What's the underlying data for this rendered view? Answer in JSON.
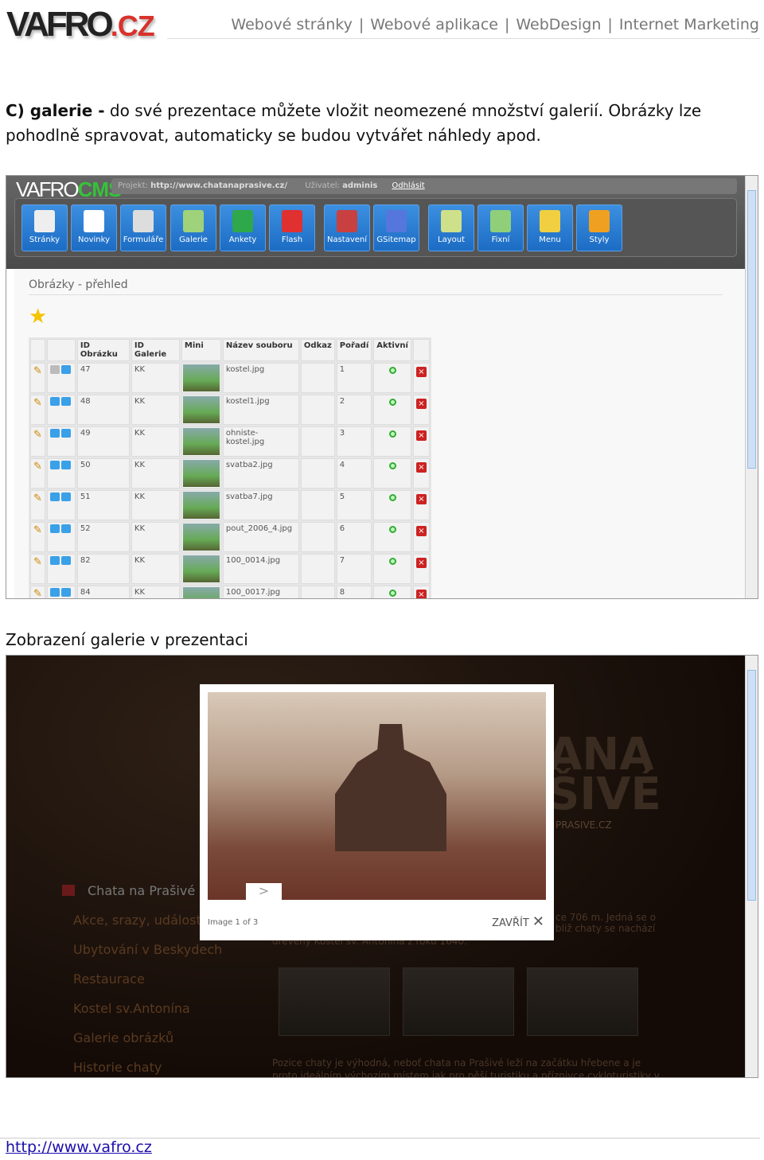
{
  "header": {
    "logo": "VAFRO",
    "logo_suffix": ".CZ",
    "nav": [
      "Webové stránky",
      "Webové aplikace",
      "WebDesign",
      "Internet Marketing"
    ],
    "nav_sep": "|"
  },
  "intro": {
    "lead": "C) galerie -",
    "text": " do své prezentace můžete vložit neomezené množství galerií. Obrázky lze pohodlně spravovat, automaticky se budou vytvářet náhledy apod."
  },
  "cms": {
    "logo": "VAFRO",
    "logo_suffix": "CMS",
    "project_label": "Projekt:",
    "project": "http://www.chatanaprasive.cz/",
    "user_label": "Uživatel:",
    "user": "adminis",
    "logout": "Odhlásit",
    "toolbar": [
      {
        "label": "Stránky",
        "color": "#eeeeee"
      },
      {
        "label": "Novinky",
        "color": "#ffffff"
      },
      {
        "label": "Formuláře",
        "color": "#dddddd"
      },
      {
        "label": "Galerie",
        "color": "#9fd27a"
      },
      {
        "label": "Ankety",
        "color": "#2ea84a"
      },
      {
        "label": "Flash",
        "color": "#e03030"
      },
      {
        "label": "Nastavení",
        "color": "#c84040"
      },
      {
        "label": "GSitemap",
        "color": "#5577dd"
      },
      {
        "label": "Layout",
        "color": "#cfe08a"
      },
      {
        "label": "Fixní",
        "color": "#8fcf7a"
      },
      {
        "label": "Menu",
        "color": "#f0d040"
      },
      {
        "label": "Styly",
        "color": "#f0a020"
      }
    ],
    "page_title": "Obrázky - přehled",
    "table": {
      "headers": [
        "",
        "",
        "ID Obrázku",
        "ID Galerie",
        "Mini",
        "Název souboru",
        "Odkaz",
        "Pořadí",
        "Aktivní",
        ""
      ],
      "rows": [
        {
          "id": "47",
          "gal": "KK",
          "file": "kostel.jpg",
          "order": "1"
        },
        {
          "id": "48",
          "gal": "KK",
          "file": "kostel1.jpg",
          "order": "2"
        },
        {
          "id": "49",
          "gal": "KK",
          "file": "ohniste-kostel.jpg",
          "order": "3"
        },
        {
          "id": "50",
          "gal": "KK",
          "file": "svatba2.jpg",
          "order": "4"
        },
        {
          "id": "51",
          "gal": "KK",
          "file": "svatba7.jpg",
          "order": "5"
        },
        {
          "id": "52",
          "gal": "KK",
          "file": "pout_2006_4.jpg",
          "order": "6"
        },
        {
          "id": "82",
          "gal": "KK",
          "file": "100_0014.jpg",
          "order": "7"
        },
        {
          "id": "84",
          "gal": "KK",
          "file": "100_0017.jpg",
          "order": "8"
        }
      ]
    }
  },
  "caption2": "Zobrazení galerie v prezentaci",
  "gallery": {
    "menu": [
      "Chata na Prašivé",
      "Akce, srazy, události",
      "Ubytování v Beskydech",
      "Restaurace",
      "Kostel sv.Antonína",
      "Galerie obrázků",
      "Historie chaty"
    ],
    "heading": [
      "ANA",
      "ŠIVÉ"
    ],
    "domain": "PRASIVE.CZ",
    "text1": "ce 706 m. Jedná se o",
    "text2": "bliž chaty se nachází",
    "text3": "dřevěný Kostel sv. Antonína z roku 1640.",
    "text4": "Pozice chaty je výhodná, neboť chata na Prašivé leží  na začátku hřebene a je",
    "text5": "proto ideálním výchozím místem jak pro pěší turistiku a příznivce cykloturistiky v",
    "lightbox": {
      "next": ">",
      "counter": "Image 1 of 3",
      "close": "ZAVŘÍT",
      "close_icon": "✕"
    }
  },
  "footer": {
    "link": "http://www.vafro.cz"
  }
}
